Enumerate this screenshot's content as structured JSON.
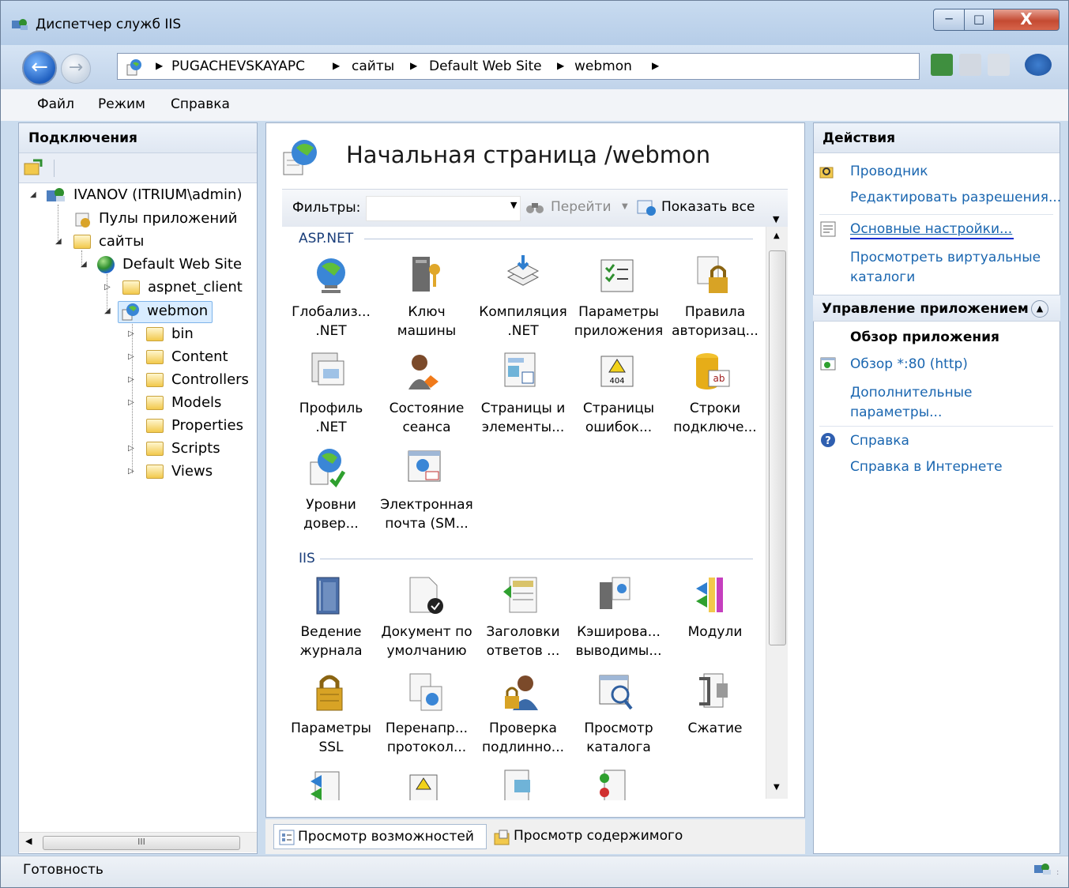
{
  "window": {
    "title": "Диспетчер служб IIS",
    "min_label": "─",
    "max_label": "□",
    "close_label": "X"
  },
  "nav": {
    "breadcrumbs": [
      "PUGACHEVSKAYAPC",
      "сайты",
      "Default Web Site",
      "webmon"
    ]
  },
  "menu": [
    "Файл",
    "Режим",
    "Справка"
  ],
  "connections": {
    "title": "Подключения",
    "tree": [
      {
        "label": "IVANOV (ITRIUM\\admin)",
        "level": 0,
        "icon": "server-icon",
        "expanded": true
      },
      {
        "label": "Пулы приложений",
        "level": 1,
        "icon": "app-pools-icon",
        "expanded": null
      },
      {
        "label": "сайты",
        "level": 1,
        "icon": "sites-folder-icon",
        "expanded": true
      },
      {
        "label": "Default Web Site",
        "level": 2,
        "icon": "globe-icon",
        "expanded": true
      },
      {
        "label": "aspnet_client",
        "level": 3,
        "icon": "folder-icon",
        "expanded": false
      },
      {
        "label": "webmon",
        "level": 3,
        "icon": "web-app-icon",
        "expanded": true,
        "selected": true
      },
      {
        "label": "bin",
        "level": 4,
        "icon": "folder-icon",
        "expanded": false
      },
      {
        "label": "Content",
        "level": 4,
        "icon": "folder-icon",
        "expanded": false
      },
      {
        "label": "Controllers",
        "level": 4,
        "icon": "folder-icon",
        "expanded": false
      },
      {
        "label": "Models",
        "level": 4,
        "icon": "folder-icon",
        "expanded": false
      },
      {
        "label": "Properties",
        "level": 4,
        "icon": "folder-icon",
        "expanded": null
      },
      {
        "label": "Scripts",
        "level": 4,
        "icon": "folder-icon",
        "expanded": false
      },
      {
        "label": "Views",
        "level": 4,
        "icon": "folder-icon",
        "expanded": false
      }
    ],
    "scroll_grip": "III"
  },
  "center": {
    "title": "Начальная страница /webmon",
    "filter_label": "Фильтры:",
    "go_label": "Перейти",
    "show_all_label": "Показать все",
    "groups": [
      {
        "name": "ASP.NET",
        "features": [
          {
            "l1": "Глобализ...",
            "l2": ".NET",
            "icon": "globalization-icon"
          },
          {
            "l1": "Ключ",
            "l2": "машины",
            "icon": "machine-key-icon"
          },
          {
            "l1": "Компиляция",
            "l2": ".NET",
            "icon": "compilation-icon"
          },
          {
            "l1": "Параметры",
            "l2": "приложения",
            "icon": "app-settings-icon"
          },
          {
            "l1": "Правила",
            "l2": "авторизац...",
            "icon": "authorization-icon"
          },
          {
            "l1": "Профиль",
            "l2": ".NET",
            "icon": "profile-icon"
          },
          {
            "l1": "Состояние",
            "l2": "сеанса",
            "icon": "session-state-icon"
          },
          {
            "l1": "Страницы и",
            "l2": "элементы...",
            "icon": "pages-controls-icon"
          },
          {
            "l1": "Страницы",
            "l2": "ошибок...",
            "icon": "error-pages-icon"
          },
          {
            "l1": "Строки",
            "l2": "подключе...",
            "icon": "connection-strings-icon"
          },
          {
            "l1": "Уровни",
            "l2": "довер...",
            "icon": "trust-levels-icon"
          },
          {
            "l1": "Электронная",
            "l2": "почта (SM...",
            "icon": "smtp-email-icon"
          }
        ]
      },
      {
        "name": "IIS",
        "features": [
          {
            "l1": "Ведение",
            "l2": "журнала",
            "icon": "logging-icon"
          },
          {
            "l1": "Документ по",
            "l2": "умолчанию",
            "icon": "default-document-icon"
          },
          {
            "l1": "Заголовки",
            "l2": "ответов ...",
            "icon": "response-headers-icon"
          },
          {
            "l1": "Кэширова...",
            "l2": "выводимы...",
            "icon": "output-caching-icon"
          },
          {
            "l1": "Модули",
            "l2": "",
            "icon": "modules-icon"
          },
          {
            "l1": "Параметры",
            "l2": "SSL",
            "icon": "ssl-settings-icon"
          },
          {
            "l1": "Перенапр...",
            "l2": "протокол...",
            "icon": "redirect-icon"
          },
          {
            "l1": "Проверка",
            "l2": "подлинно...",
            "icon": "authentication-icon"
          },
          {
            "l1": "Просмотр",
            "l2": "каталога",
            "icon": "directory-browsing-icon"
          },
          {
            "l1": "Сжатие",
            "l2": "",
            "icon": "compression-icon"
          }
        ]
      }
    ],
    "tabs": [
      "Просмотр возможностей",
      "Просмотр содержимого"
    ],
    "active_tab": 0
  },
  "actions": {
    "title": "Действия",
    "items": [
      {
        "label": "Проводник",
        "icon": "explorer-icon"
      },
      {
        "label": "Редактировать разрешения...",
        "icon": ""
      }
    ],
    "basic_settings": "Основные настройки...",
    "virtual_dirs": [
      "Просмотреть виртуальные",
      "каталоги"
    ],
    "manage_title": "Управление приложением",
    "browse_title": "Обзор приложения",
    "browse_link": "Обзор *:80 (http)",
    "advanced": [
      "Дополнительные",
      "параметры..."
    ],
    "help": "Справка",
    "help_online": "Справка в Интернете"
  },
  "status": {
    "text": "Готовность"
  },
  "colors": {
    "link": "#1a66b0",
    "selection": "#d9ecff",
    "close_button": "#c44a32"
  }
}
